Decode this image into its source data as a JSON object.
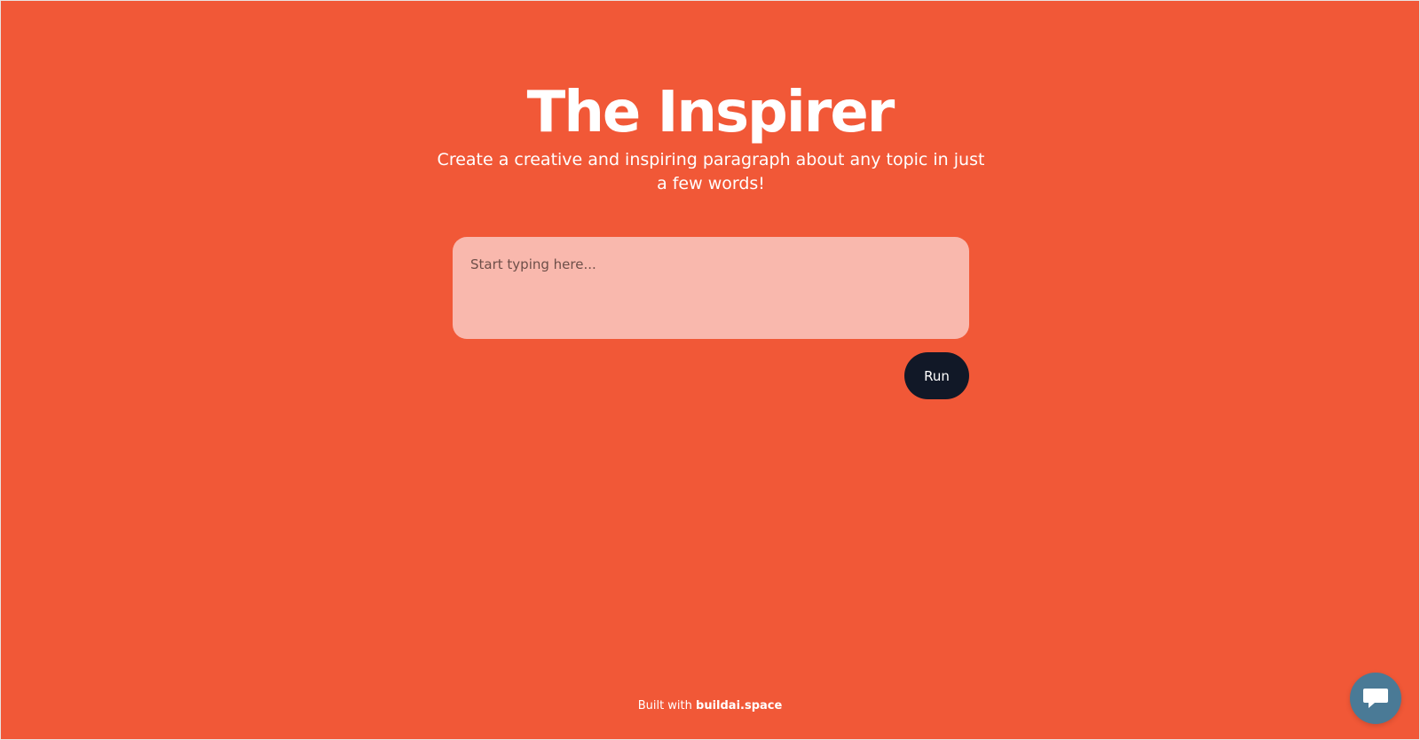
{
  "app": {
    "title": "The Inspirer",
    "subtitle": "Create a creative and inspiring paragraph about any topic in just a few words!"
  },
  "form": {
    "input_value": "",
    "input_placeholder": "Start typing here...",
    "run_label": "Run"
  },
  "footer": {
    "prefix": "Built with ",
    "brand": "buildai.space"
  },
  "chat": {
    "icon": "chat-bubble-icon"
  },
  "colors": {
    "background": "#f15837",
    "input_background": "#f9b8ad",
    "button_background": "#111827",
    "chat_button": "#4a7a96"
  }
}
